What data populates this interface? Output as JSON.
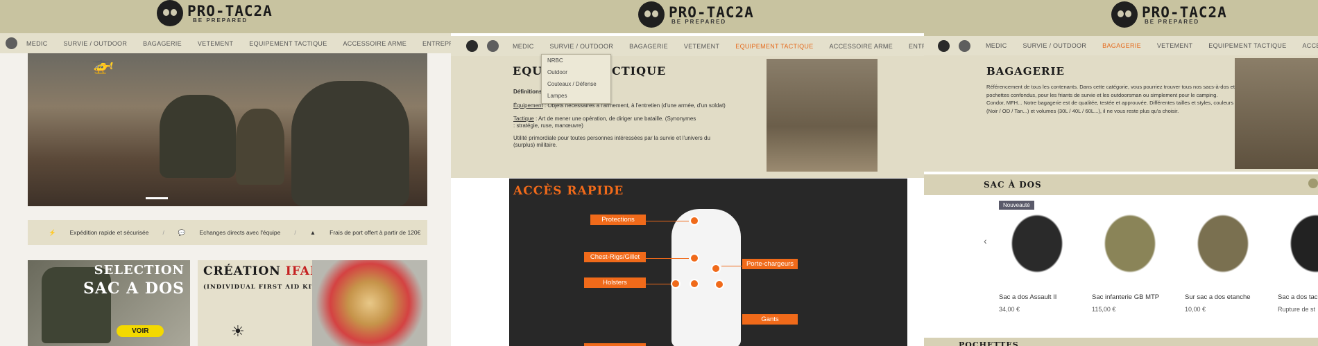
{
  "brand": {
    "name": "PRO-TAC2A",
    "tagline": "BE PREPARED"
  },
  "panel1": {
    "nav": [
      "MEDIC",
      "SURVIE / OUTDOOR",
      "BAGAGERIE",
      "VETEMENT",
      "EQUIPEMENT TACTIQUE",
      "ACCESSOIRE ARME",
      "ENTREPRISE"
    ],
    "features": [
      "Expédition rapide et sécurisée",
      "Echanges directs avec l'équipe",
      "Frais de port offert à partir de 120€"
    ],
    "card1": {
      "line1": "SELECTION",
      "line2": "SAC A DOS",
      "button": "VOIR"
    },
    "card2": {
      "title_a": "CRÉATION ",
      "title_b": "IFAK",
      "subtitle": "(INDIVIDUAL FIRST AID KIT)"
    }
  },
  "panel2": {
    "nav": [
      "MEDIC",
      "SURVIE / OUTDOOR",
      "BAGAGERIE",
      "VETEMENT",
      "EQUIPEMENT TACTIQUE",
      "ACCESSOIRE ARME",
      "ENTREPRISE"
    ],
    "active": "EQUIPEMENT TACTIQUE",
    "dropdown": [
      "NRBC",
      "Outdoor",
      "Couteaux / Défense",
      "Lampes"
    ],
    "title_left": "EQUI",
    "title_right": "CTIQUE",
    "def_label": "Définitions",
    "def1_term": "Équipement",
    "def1_text": " : Objets nécessaires à l'armement, à l'entretien (d'une armée, d'un soldat)",
    "def2_term": "Tactique",
    "def2_text": " : Art de mener une opération, de diriger une bataille. (Synonymes",
    "def2_text2": ": stratégie, ruse, manœuvre)",
    "def3": "Utilité primordiale pour toutes personnes intéressées par la survie et l'univers du",
    "def3b": "(surplus) militaire.",
    "quick_title": "ACCÈS RAPIDE",
    "quick_labels": [
      "Protections",
      "Chest-Rigs/Gillet",
      "Holsters",
      "Porte-chargeurs",
      "Gants"
    ]
  },
  "panel3": {
    "nav": [
      "MEDIC",
      "SURVIE / OUTDOOR",
      "BAGAGERIE",
      "VETEMENT",
      "EQUIPEMENT TACTIQUE",
      "ACCESSOIRE ARME"
    ],
    "active": "BAGAGERIE",
    "title": "BAGAGERIE",
    "desc": [
      "Référencement de tous les contenants. Dans cette catégorie, vous pourriez trouver tous nos sacs-à-dos et",
      "pochettes confondus, pour les friants de survie et les outdoorsman ou simplement pour le camping.",
      "Condor, MFH... Notre bagagerie est de qualitée, testée et approuvée. Différentes tailles et styles, couleurs",
      "(Noir / OD / Tan...) et volumes (30L / 40L / 60L...), il ne vous reste plus qu'a choisir."
    ],
    "section": "SAC À DOS",
    "section2": "POCHETTES",
    "badge": "Nouveauté",
    "products": [
      {
        "name": "Sac a dos Assault II",
        "price": "34,00 €",
        "color": "#1e1e1e"
      },
      {
        "name": "Sac infanterie GB MTP",
        "price": "115,00 €",
        "color": "#8a8458"
      },
      {
        "name": "Sur sac a dos etanche",
        "price": "10,00 €",
        "color": "#7a7050"
      },
      {
        "name": "Sac a dos tac",
        "price": "Rupture de st",
        "color": "#222222"
      }
    ]
  },
  "colors": {
    "accent": "#e56a1c",
    "khaki": "#c8c3a0"
  }
}
